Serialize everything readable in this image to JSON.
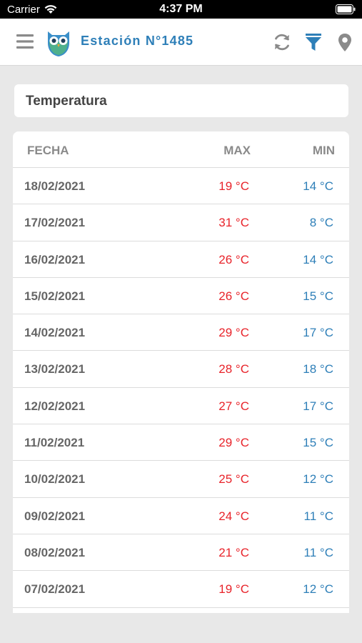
{
  "status_bar": {
    "carrier": "Carrier",
    "time": "4:37 PM"
  },
  "nav": {
    "title": "Estación N°1485",
    "brand_color": "#2e7fb8",
    "icons": [
      "menu-icon",
      "owl-logo",
      "refresh-icon",
      "filter-icon",
      "location-pin-icon"
    ]
  },
  "section": {
    "title": "Temperatura"
  },
  "table": {
    "headers": {
      "date": "FECHA",
      "max": "MAX",
      "min": "MIN"
    },
    "max_color": "#e8232a",
    "min_color": "#2e7fb8",
    "rows": [
      {
        "date": "18/02/2021",
        "max": "19 °C",
        "min": "14 °C"
      },
      {
        "date": "17/02/2021",
        "max": "31 °C",
        "min": "8 °C"
      },
      {
        "date": "16/02/2021",
        "max": "26 °C",
        "min": "14 °C"
      },
      {
        "date": "15/02/2021",
        "max": "26 °C",
        "min": "15 °C"
      },
      {
        "date": "14/02/2021",
        "max": "29 °C",
        "min": "17 °C"
      },
      {
        "date": "13/02/2021",
        "max": "28 °C",
        "min": "18 °C"
      },
      {
        "date": "12/02/2021",
        "max": "27 °C",
        "min": "17 °C"
      },
      {
        "date": "11/02/2021",
        "max": "29 °C",
        "min": "15 °C"
      },
      {
        "date": "10/02/2021",
        "max": "25 °C",
        "min": "12 °C"
      },
      {
        "date": "09/02/2021",
        "max": "24 °C",
        "min": "11 °C"
      },
      {
        "date": "08/02/2021",
        "max": "21 °C",
        "min": "11 °C"
      },
      {
        "date": "07/02/2021",
        "max": "19 °C",
        "min": "12 °C"
      }
    ]
  }
}
